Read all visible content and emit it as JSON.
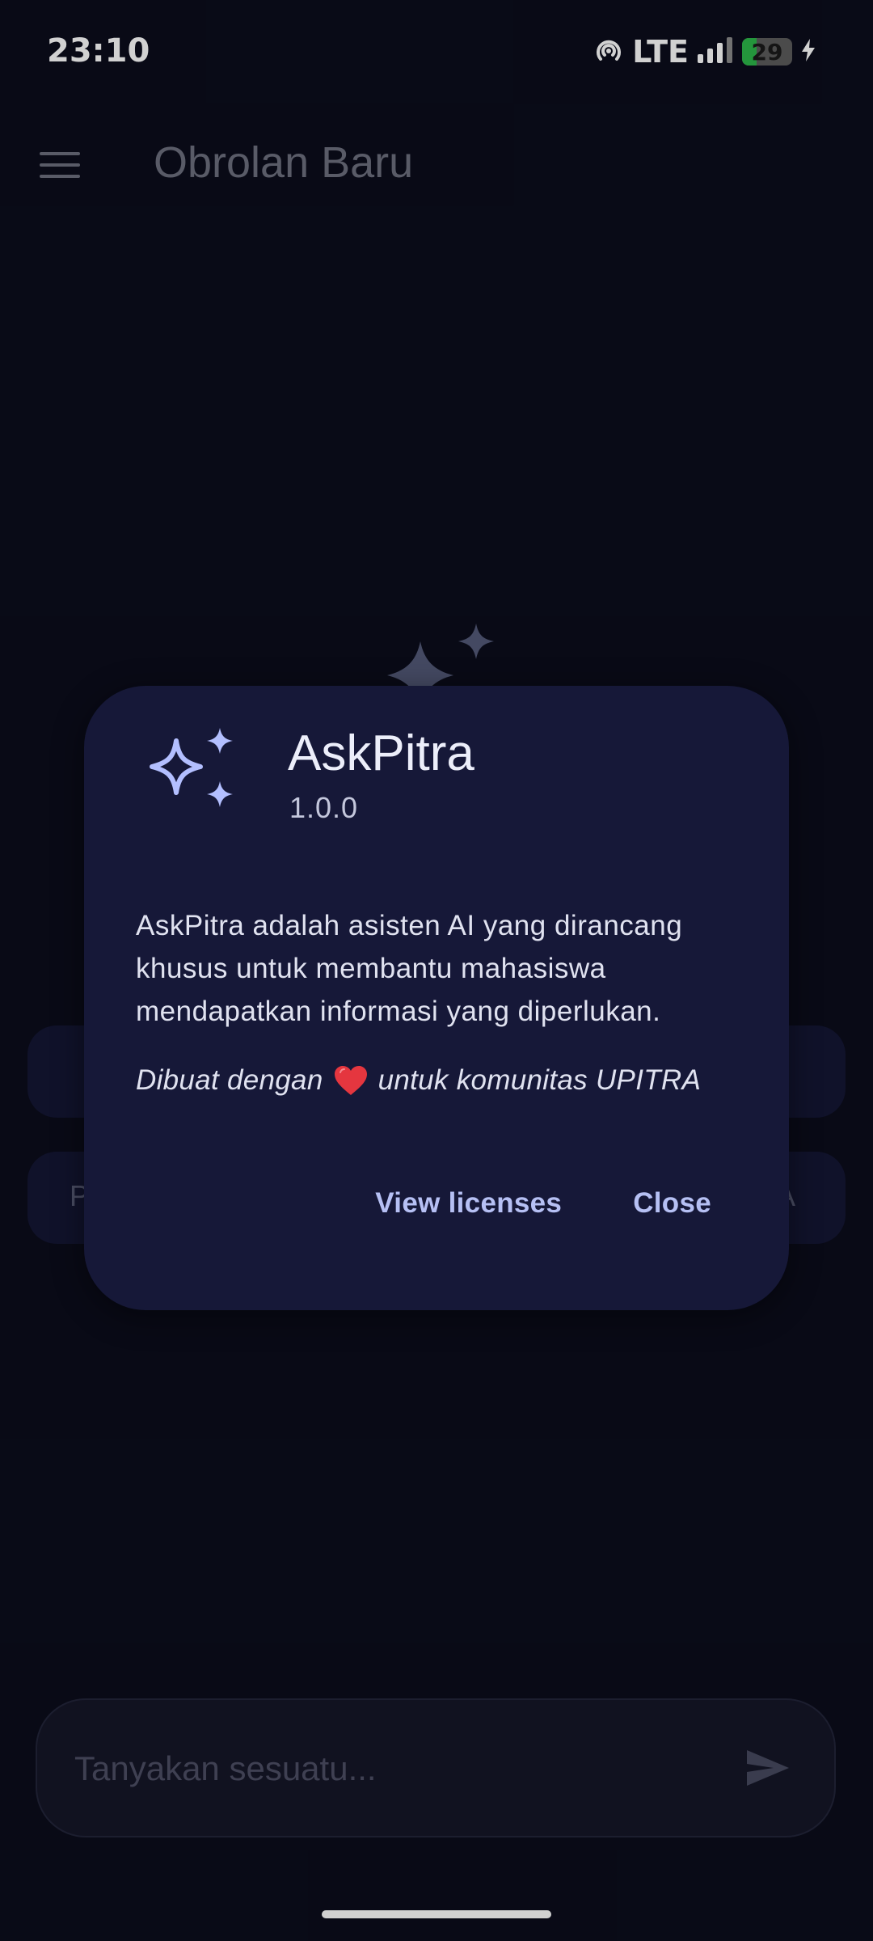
{
  "status_bar": {
    "time": "23:10",
    "network": "LTE",
    "battery_percent": 29,
    "battery_text": "29",
    "charging": true
  },
  "app_bar": {
    "title": "Obrolan Baru",
    "menu_icon": "hamburger-menu-icon"
  },
  "background": {
    "suggestions": [
      {
        "text": "",
        "trail": ""
      },
      {
        "text": "P",
        "trail": "A"
      }
    ]
  },
  "dialog": {
    "app_name": "AskPitra",
    "version": "1.0.0",
    "description": "AskPitra adalah asisten AI yang dirancang khusus untuk membantu mahasiswa mendapatkan informasi yang diperlukan.",
    "credit_before": "Dibuat dengan",
    "credit_after": "untuk komunitas UPITRA",
    "view_licenses_label": "View licenses",
    "close_label": "Close"
  },
  "input": {
    "placeholder": "Tanyakan sesuatu...",
    "value": ""
  },
  "colors": {
    "background": "#0b0d1c",
    "dialog": "#161838",
    "accent": "#b6c0f4",
    "sparkle": "#b3bfff"
  }
}
